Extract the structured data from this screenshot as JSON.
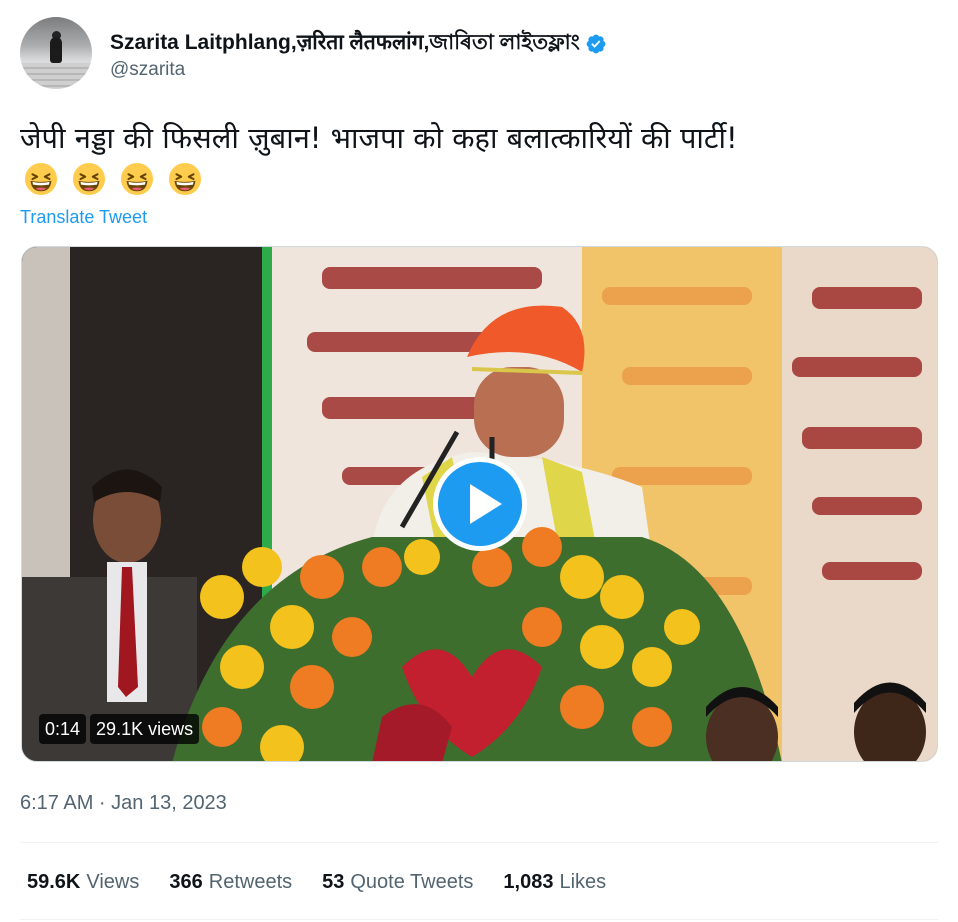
{
  "author": {
    "display_name": "Szarita Laitphlang,ज़रिता लैतफलांग,জাৰিতা লাইতফ্লাং",
    "handle": "@szarita",
    "verified": true
  },
  "tweet": {
    "text": "जेपी नड्डा की फिसली ज़ुबान! भाजपा को कहा बलात्कारियों की पार्टी!",
    "emojis": [
      "grinning-squinting-face",
      "grinning-squinting-face",
      "grinning-squinting-face",
      "grinning-squinting-face"
    ],
    "translate_label": "Translate Tweet"
  },
  "media": {
    "duration": "0:14",
    "views": "29.1K views",
    "play_icon": "play-icon"
  },
  "timestamp": "6:17 AM · Jan 13, 2023",
  "stats": {
    "views": {
      "num": "59.6K",
      "label": "Views"
    },
    "retweets": {
      "num": "366",
      "label": "Retweets"
    },
    "quotes": {
      "num": "53",
      "label": "Quote Tweets"
    },
    "likes": {
      "num": "1,083",
      "label": "Likes"
    }
  },
  "colors": {
    "accent": "#1d9bf0",
    "muted": "#536471",
    "text": "#0f1419"
  }
}
